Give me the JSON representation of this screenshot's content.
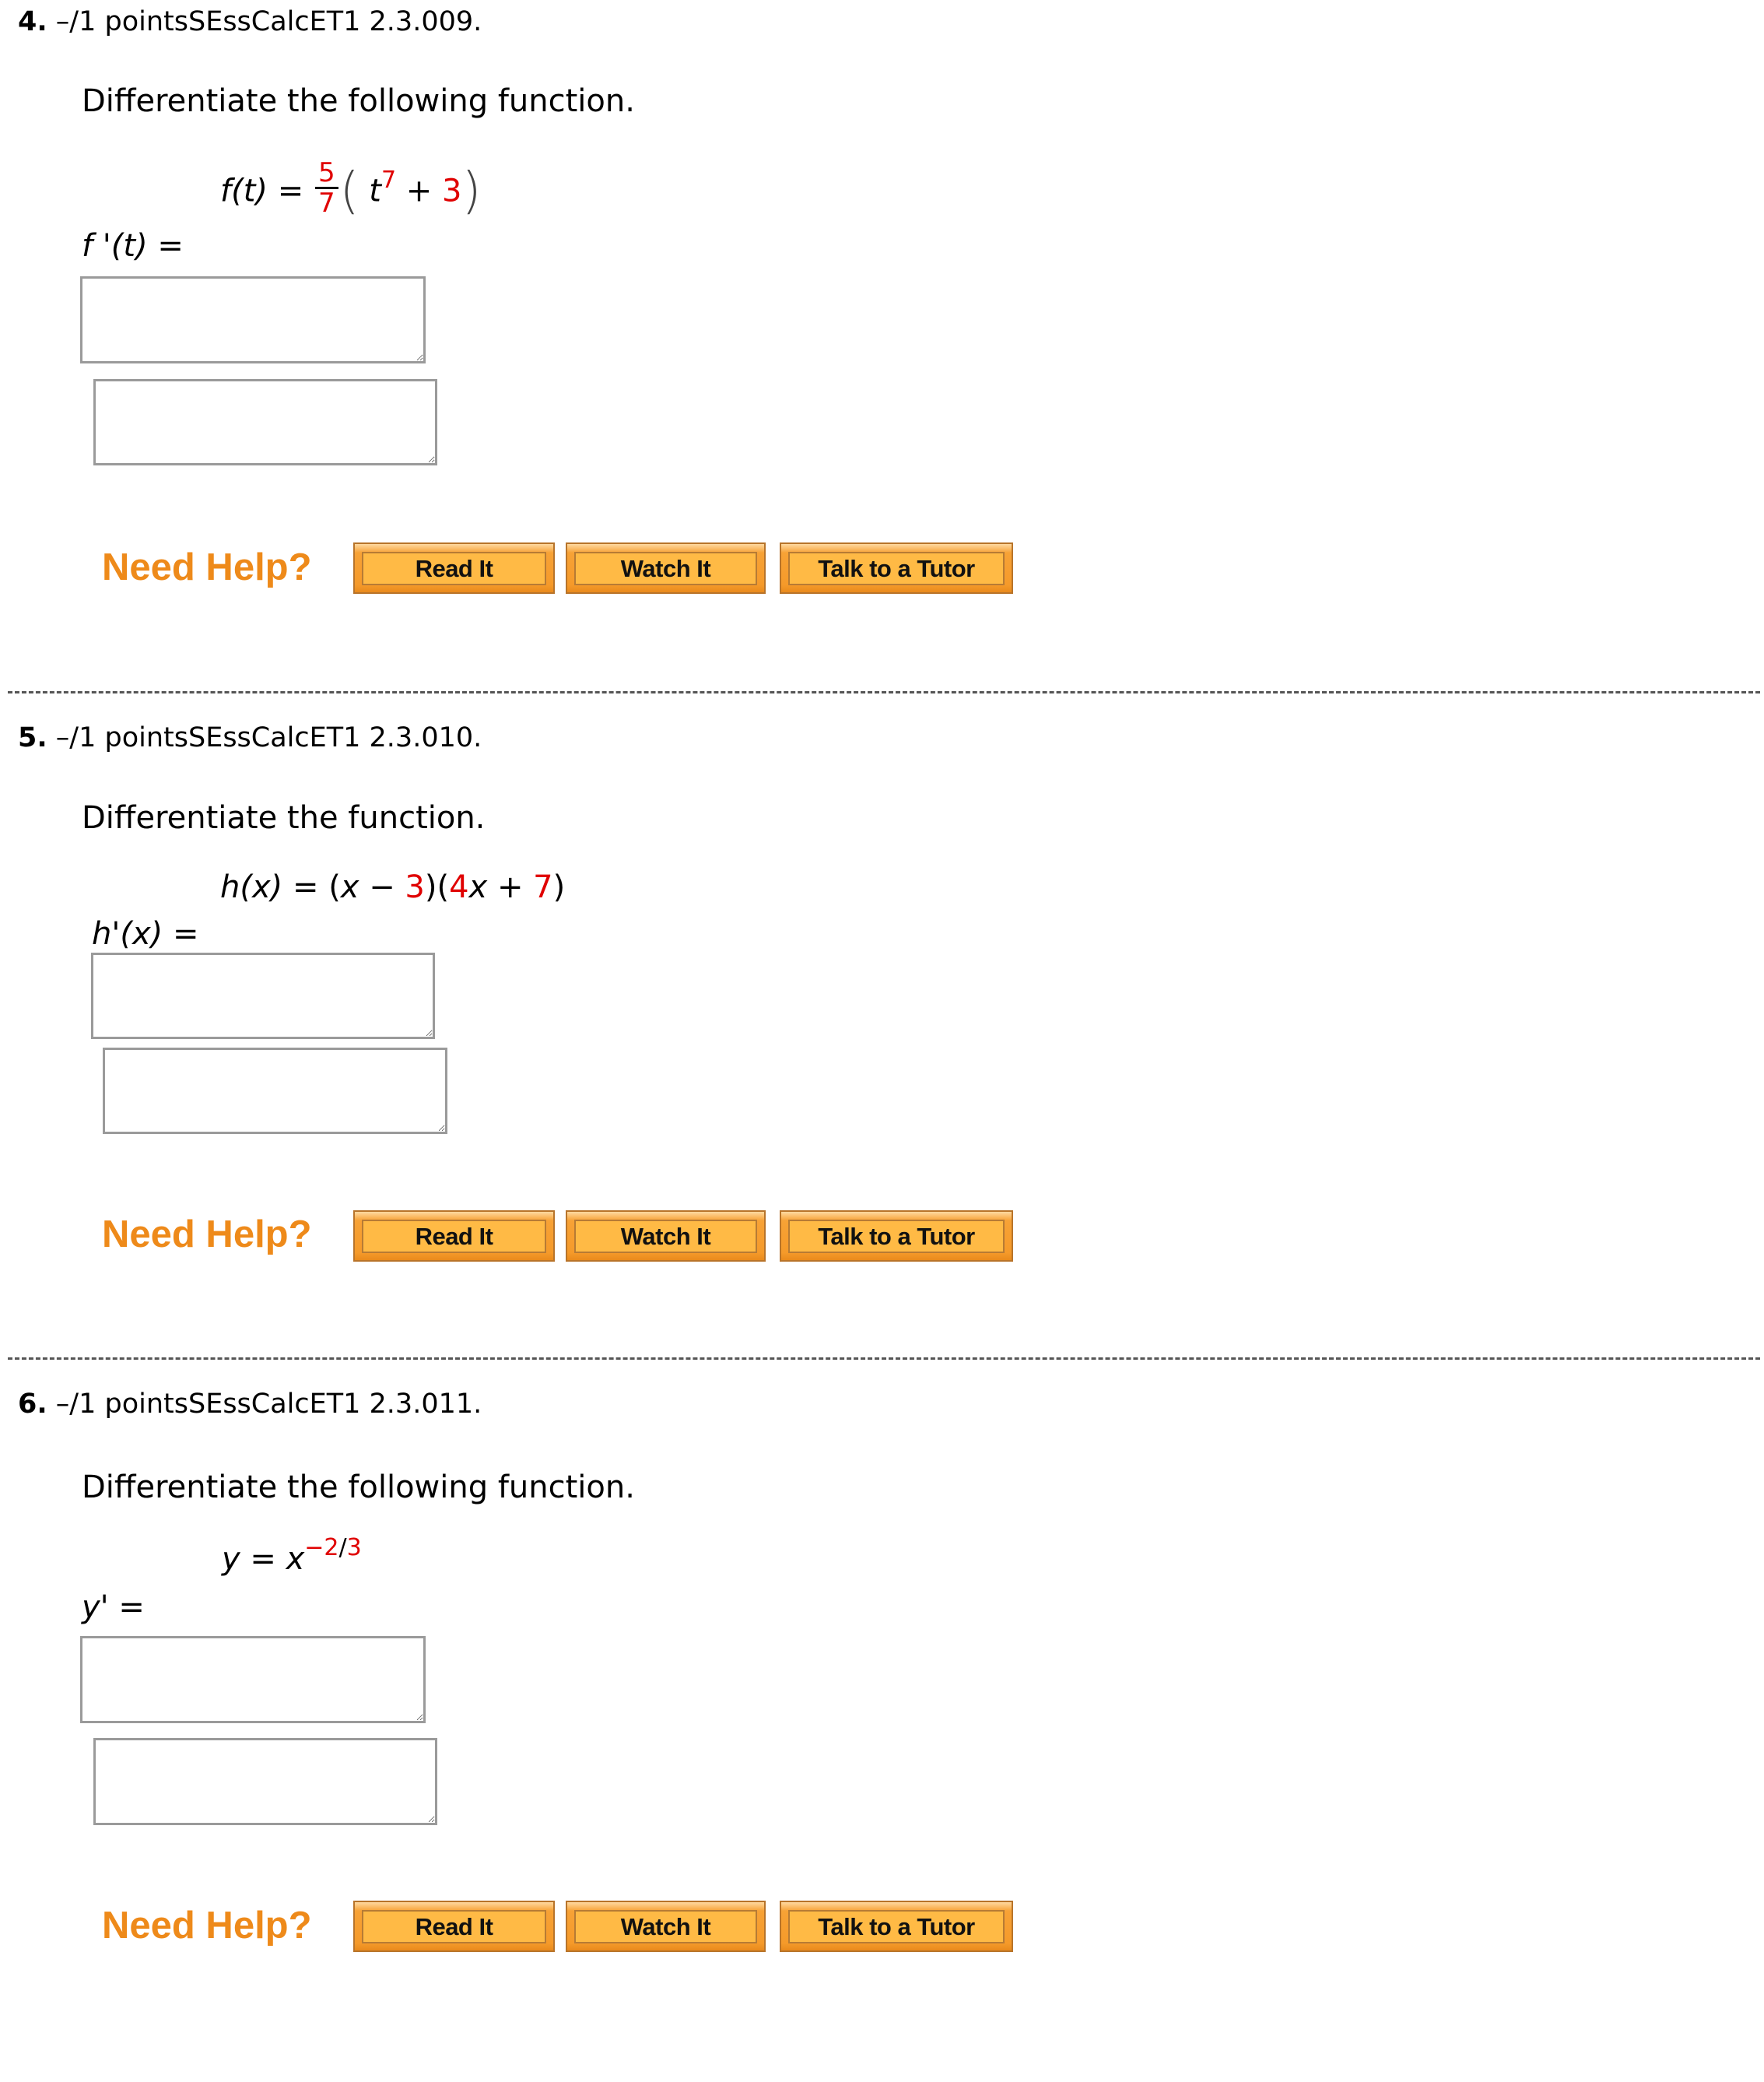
{
  "questions": [
    {
      "number": "4.",
      "points": "–/1 points",
      "source": "SEssCalcET1 2.3.009.",
      "prompt": "Differentiate the following function.",
      "formula": {
        "lhs": "f(t)",
        "eq": "=",
        "frac_num": "5",
        "frac_den": "7",
        "lparen": "(",
        "var": "t",
        "exp": "7",
        "plus": "+",
        "const": "3",
        "rparen": ")"
      },
      "answer_label": "f '(t) =",
      "answer_values": [
        "",
        ""
      ]
    },
    {
      "number": "5.",
      "points": "–/1 points",
      "source": "SEssCalcET1 2.3.010.",
      "prompt": "Differentiate the function.",
      "formula": {
        "lhs": "h(x)",
        "eq": "=",
        "p1_open": "(",
        "var1": "x",
        "minus": "−",
        "c1": "3",
        "p1_close": ")(",
        "coef": "4",
        "var2": "x",
        "plus": "+",
        "c2": "7",
        "p2_close": ")"
      },
      "answer_label": "h'(x) =",
      "answer_values": [
        "",
        ""
      ]
    },
    {
      "number": "6.",
      "points": "–/1 points",
      "source": "SEssCalcET1 2.3.011.",
      "prompt": "Differentiate the following function.",
      "formula": {
        "lhs": "y",
        "eq": "=",
        "base": "x",
        "exp_num": "−2",
        "exp_slash": "/",
        "exp_den": "3"
      },
      "answer_label": "y' =",
      "answer_values": [
        "",
        ""
      ]
    }
  ],
  "help": {
    "label": "Need Help?",
    "read_it": "Read It",
    "watch_it": "Watch It",
    "talk_to_tutor": "Talk to a Tutor"
  },
  "colors": {
    "highlight_red": "#e00000",
    "need_help_orange": "#ee8a1a",
    "button_orange": "#f7a236"
  }
}
